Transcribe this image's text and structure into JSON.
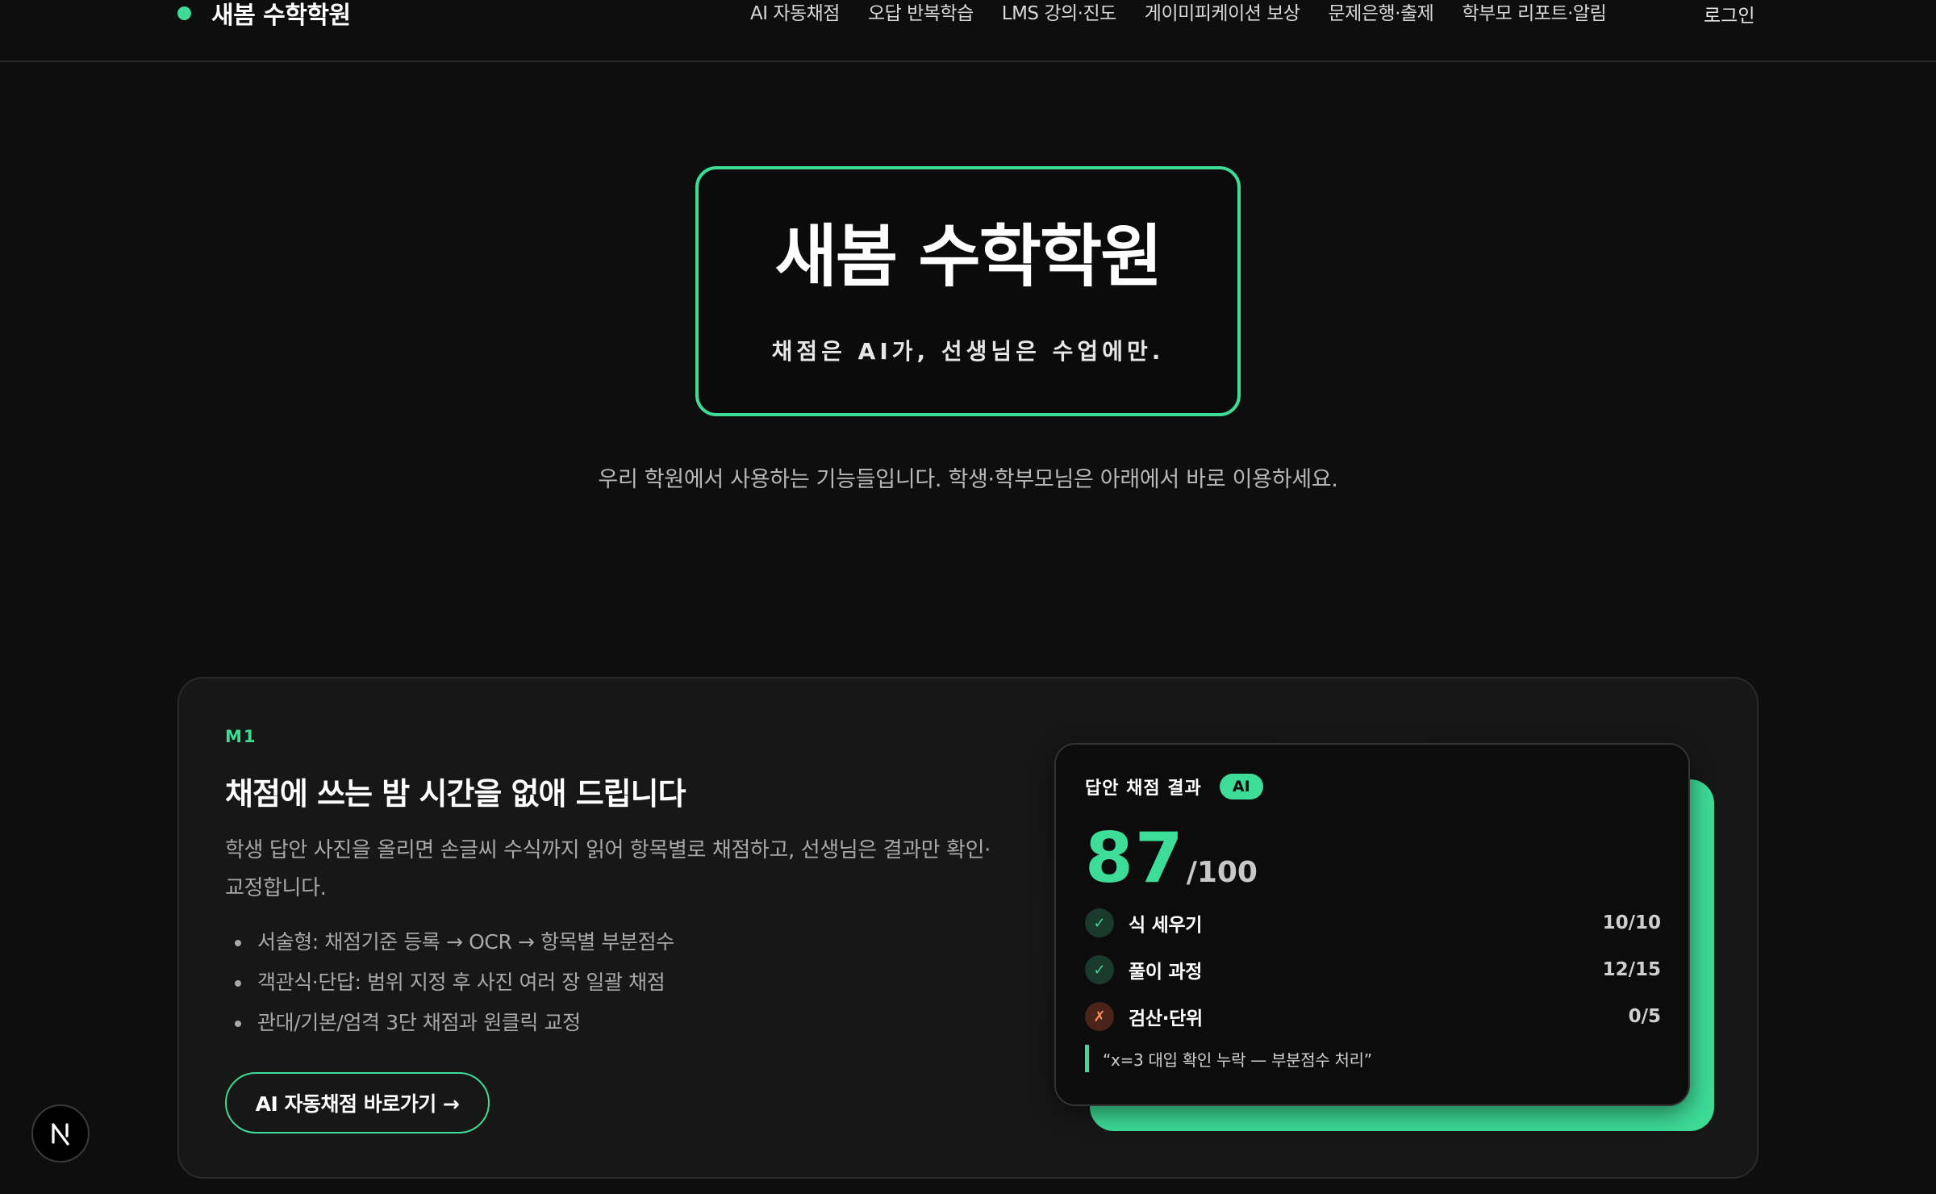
{
  "header": {
    "brand": "새봄 수학학원",
    "nav": [
      "AI 자동채점",
      "오답 반복학습",
      "LMS 강의·진도",
      "게이미피케이션 보상",
      "문제은행·출제",
      "학부모 리포트·알림"
    ],
    "login": "로그인"
  },
  "hero": {
    "title": "새봄 수학학원",
    "subtitle": "채점은 AI가, 선생님은 수업에만.",
    "description": "우리 학원에서 사용하는 기능들입니다. 학생·학부모님은 아래에서 바로 이용하세요."
  },
  "feature": {
    "code": "M1",
    "title": "채점에 쓰는 밤 시간을 없애 드립니다",
    "description": "학생 답안 사진을 올리면 손글씨 수식까지 읽어 항목별로 채점하고, 선생님은 결과만 확인·교정합니다.",
    "bullets": [
      "서술형: 채점기준 등록 → OCR → 항목별 부분점수",
      "객관식·단답: 범위 지정 후 사진 여러 장 일괄 채점",
      "관대/기본/엄격 3단 채점과 원클릭 교정"
    ],
    "cta": "AI 자동채점 바로가기 →"
  },
  "result_card": {
    "title": "답안 채점 결과",
    "badge": "AI",
    "score": "87",
    "max": "/100",
    "criteria": [
      {
        "label": "식 세우기",
        "score": "10/10",
        "status": "pass",
        "icon": "✓"
      },
      {
        "label": "풀이 과정",
        "score": "12/15",
        "status": "pass",
        "icon": "✓"
      },
      {
        "label": "검산·단위",
        "score": "0/5",
        "status": "fail",
        "icon": "✗"
      }
    ],
    "note": "“x=3 대입 확인 누락 — 부분점수 처리”"
  },
  "colors": {
    "accent": "#3ddc97",
    "background": "#0e0e0e",
    "panel": "#171717",
    "fail": "#ff8f5a"
  }
}
